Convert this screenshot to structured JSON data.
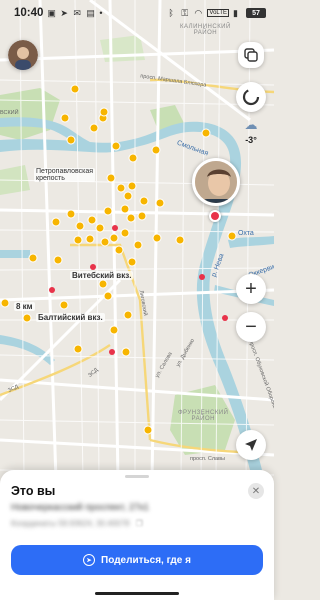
{
  "status_bar": {
    "time": "10:40",
    "left_icons": [
      "photo-icon",
      "telegram-icon",
      "mail-icon",
      "message-icon",
      "dot-icon"
    ],
    "right_icons": [
      "bluetooth-icon",
      "key-icon",
      "wifi-icon",
      "volte-icon",
      "signal-icon"
    ],
    "network_label": "VoLTE",
    "battery": "57"
  },
  "map": {
    "labels": {
      "kalininsky": "КАЛИНИНСКИЙ\nРАЙОН",
      "marshal": "просп. Маршала Блюхера",
      "petropavlovsk": "Петропавловская\nкрепость",
      "smolny": "Смольная",
      "okhta": "Охта",
      "okkervil": "Оккерви",
      "neva": "р. Нева",
      "vitebsky": "Витебский вкз.",
      "baltiysky": "Балтийский вкз.",
      "distance": "8 км",
      "dostoevsky": "ул. Дыбенко",
      "frunze": "ФРУНЗЕНСКИЙ\nРАЙОН",
      "slavy": "просп. Славы",
      "wshd": "ЗСД",
      "vshd": "ЗСД",
      "salova": "ул. Салова",
      "obukhov": "просп. Обуховской Обороны",
      "ligovsky": "Лиговский",
      "kim": "ВСКИЙ"
    }
  },
  "controls": {
    "weather_temp": "-3°",
    "zoom_in": "+",
    "zoom_out": "−"
  },
  "sheet": {
    "title": "Это вы",
    "close": "✕",
    "address": "Новочеркасский проспект, 27к1",
    "coords_label": "Координаты",
    "coords_value": "59.93624, 30.40078",
    "share_label": "Поделиться, где я"
  },
  "colors": {
    "accent": "#2d6df6",
    "water": "#aad3df",
    "park": "#c8dfb4",
    "pin": "#f7b500",
    "location": "#e8334a"
  }
}
